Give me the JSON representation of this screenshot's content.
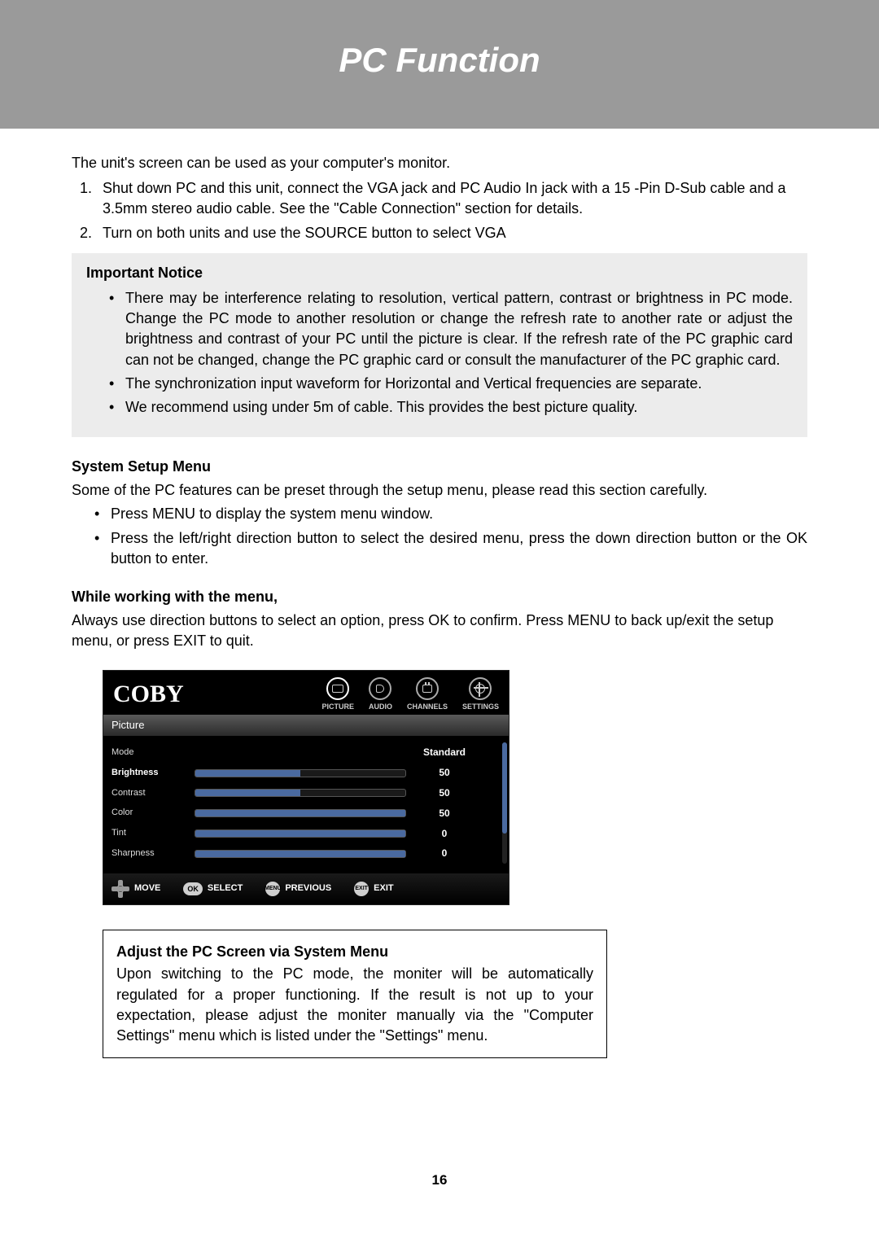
{
  "header": {
    "title": "PC Function"
  },
  "intro": "The unit's screen can be used as your computer's monitor.",
  "steps": [
    "Shut down PC and this unit, connect the VGA jack and PC Audio In jack with a 15 -Pin D-Sub cable and a 3.5mm stereo audio cable. See the  \"Cable Connection\" section for details.",
    "Turn on both units and use the SOURCE button to select VGA"
  ],
  "notice": {
    "title": "Important Notice",
    "bullets": [
      "There may be interference relating to resolution, vertical pattern, contrast or brightness in PC mode. Change the PC mode to another resolution or change the refresh rate to another rate or adjust the brightness and contrast of your PC until the picture is clear. If the refresh rate of the PC graphic card can not be changed, change the PC graphic card or consult the manufacturer of the PC graphic card.",
      "The synchronization input waveform for Horizontal and Vertical frequencies are separate.",
      "We recommend using under 5m of cable. This provides the best picture quality."
    ]
  },
  "system_menu": {
    "heading": "System Setup Menu",
    "intro": "Some of the PC features can be preset through the setup menu, please read this section carefully.",
    "bullets": [
      "Press MENU to display the system menu window.",
      "Press the left/right direction button to select the desired menu, press the down direction button or the OK button to enter."
    ]
  },
  "working": {
    "heading": "While working with the menu,",
    "body": "Always use direction buttons to select an option, press OK to confirm. Press MENU to back up/exit the setup menu, or press EXIT to quit."
  },
  "osd": {
    "logo": "COBY",
    "tabs": [
      {
        "label": "PICTURE",
        "active": true
      },
      {
        "label": "AUDIO",
        "active": false
      },
      {
        "label": "CHANNELS",
        "active": false
      },
      {
        "label": "SETTINGS",
        "active": false
      }
    ],
    "section": "Picture",
    "rows": [
      {
        "label": "Mode",
        "value": "Standard",
        "type": "text"
      },
      {
        "label": "Brightness",
        "value": 50,
        "type": "slider",
        "fill": 50
      },
      {
        "label": "Contrast",
        "value": 50,
        "type": "slider",
        "fill": 50
      },
      {
        "label": "Color",
        "value": 50,
        "type": "slider",
        "fill": 100
      },
      {
        "label": "Tint",
        "value": 0,
        "type": "slider",
        "fill": 100
      },
      {
        "label": "Sharpness",
        "value": 0,
        "type": "slider",
        "fill": 100
      }
    ],
    "footer": {
      "move": "MOVE",
      "select_btn": "OK",
      "select": "SELECT",
      "prev_btn": "MENU",
      "prev": "PREVIOUS",
      "exit_btn": "EXIT",
      "exit": "EXIT"
    }
  },
  "adjust_box": {
    "title": "Adjust the PC Screen via System Menu",
    "body": "Upon switching to the PC mode, the moniter will be automatically regulated for a proper functioning. If the result is not up to your expectation, please adjust the moniter manually via the \"Computer Settings\" menu which is listed under the \"Settings\" menu."
  },
  "page_number": "16"
}
